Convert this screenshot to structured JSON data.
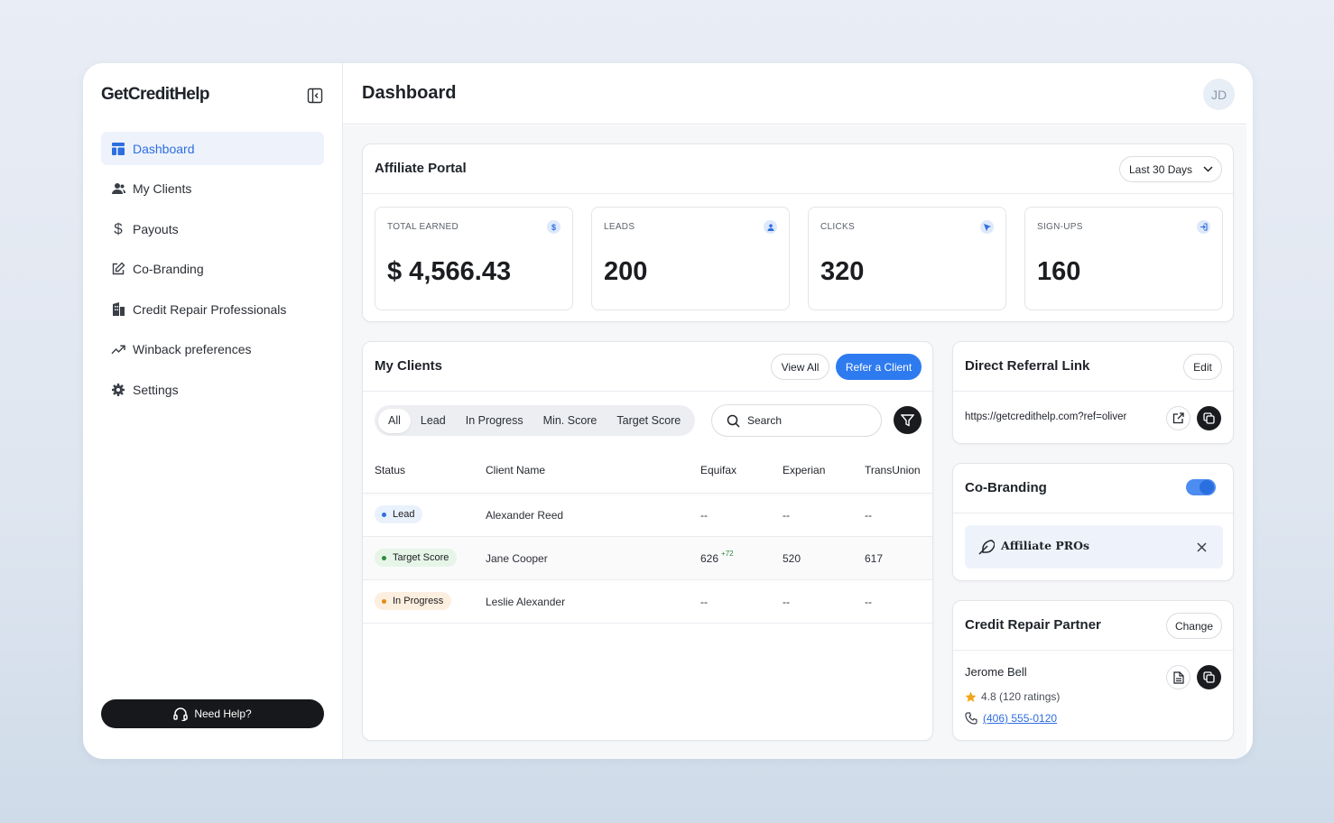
{
  "app": {
    "logo": "GetCreditHelp"
  },
  "sidebar": {
    "items": [
      {
        "label": "Dashboard",
        "icon": "dashboard-icon",
        "active": true
      },
      {
        "label": "My Clients",
        "icon": "users-icon"
      },
      {
        "label": "Payouts",
        "icon": "dollar-icon"
      },
      {
        "label": "Co-Branding",
        "icon": "edit-icon"
      },
      {
        "label": "Credit Repair Professionals",
        "icon": "building-icon"
      },
      {
        "label": "Winback preferences",
        "icon": "trend-icon"
      },
      {
        "label": "Settings",
        "icon": "gear-icon"
      }
    ],
    "help_label": "Need Help?"
  },
  "header": {
    "title": "Dashboard",
    "avatar_initials": "JD"
  },
  "affiliate": {
    "title": "Affiliate Portal",
    "range_label": "Last 30 Days",
    "stats": [
      {
        "label": "TOTAL EARNED",
        "value": "$ 4,566.43",
        "icon": "dollar-icon"
      },
      {
        "label": "LEADS",
        "value": "200",
        "icon": "user-icon"
      },
      {
        "label": "CLICKS",
        "value": "320",
        "icon": "cursor-icon"
      },
      {
        "label": "SIGN-UPS",
        "value": "160",
        "icon": "signin-icon"
      }
    ]
  },
  "clients": {
    "title": "My Clients",
    "view_all": "View All",
    "refer": "Refer a Client",
    "filters": [
      "All",
      "Lead",
      "In Progress",
      "Min. Score",
      "Target Score"
    ],
    "search_label": "Search",
    "columns": [
      "Status",
      "Client Name",
      "Equifax",
      "Experian",
      "TransUnion"
    ],
    "rows": [
      {
        "status": "Lead",
        "name": "Alexander Reed",
        "equifax": "--",
        "equifax_delta": "",
        "experian": "--",
        "transunion": "--"
      },
      {
        "status": "Target Score",
        "name": "Jane Cooper",
        "equifax": "626",
        "equifax_delta": "+72",
        "experian": "520",
        "transunion": "617"
      },
      {
        "status": "In Progress",
        "name": "Leslie Alexander",
        "equifax": "--",
        "equifax_delta": "",
        "experian": "--",
        "transunion": "--"
      }
    ],
    "status_colors": {
      "Lead": {
        "bg": "#e9f1fc",
        "dot": "#2e6ee0"
      },
      "Target Score": {
        "bg": "#e6f5e8",
        "dot": "#2f8a3c"
      },
      "In Progress": {
        "bg": "#fdefdf",
        "dot": "#e58a16"
      }
    }
  },
  "referral": {
    "title": "Direct Referral Link",
    "edit": "Edit",
    "url": "https://getcredithelp.com?ref=oliver"
  },
  "cobranding": {
    "title": "Co-Branding",
    "enabled": true,
    "brand_name": "Affiliate PROs"
  },
  "partner": {
    "title": "Credit Repair Partner",
    "change": "Change",
    "name": "Jerome Bell",
    "rating": "4.8 (120 ratings)",
    "phone": "(406) 555-0120"
  },
  "colors": {
    "accent": "#2e7bf0",
    "dark": "#17181b"
  }
}
